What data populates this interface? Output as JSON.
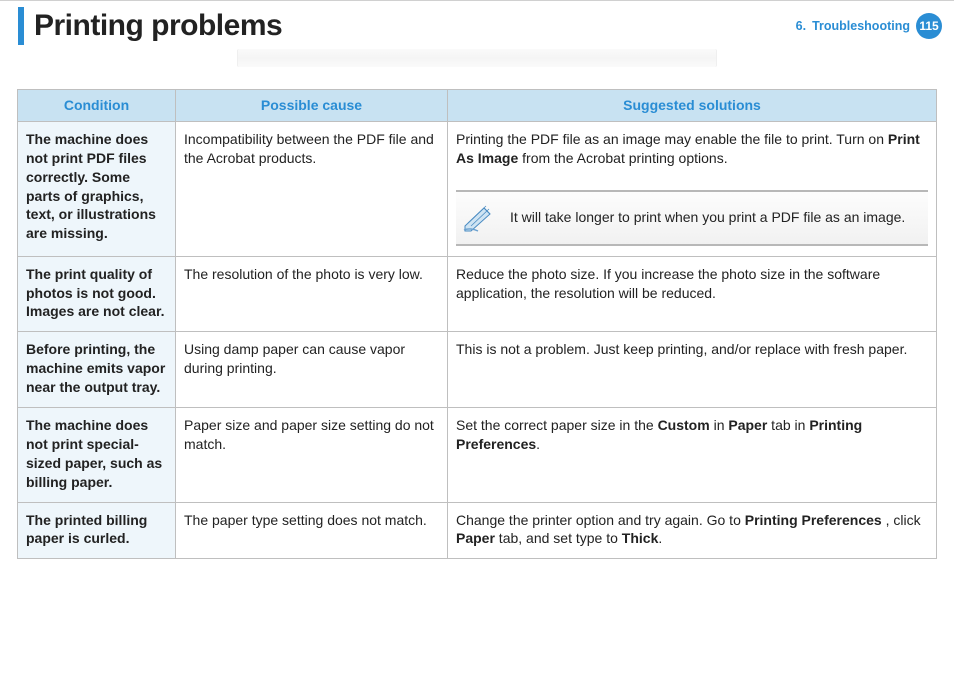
{
  "header": {
    "title": "Printing problems",
    "chapter_num": "6.",
    "chapter_name": "Troubleshooting",
    "page_number": "115"
  },
  "table": {
    "headers": {
      "condition": "Condition",
      "cause": "Possible cause",
      "solution": "Suggested solutions"
    },
    "rows": [
      {
        "condition": "The machine does not print PDF files correctly. Some parts of graphics, text, or illustrations are missing.",
        "cause": "Incompatibility between the PDF file and the Acrobat products.",
        "solution_pre": "Printing the PDF file as an image may enable the file to print. Turn on ",
        "solution_bold1": "Print As Image",
        "solution_post": " from the Acrobat printing options.",
        "note": "It will take longer to print when you print a PDF file as an image."
      },
      {
        "condition": "The print quality of photos is not good. Images are not clear.",
        "cause": "The resolution of the photo is very low.",
        "solution_plain": "Reduce the photo size. If you increase the photo size in the software application, the resolution will be reduced."
      },
      {
        "condition": "Before printing, the machine emits vapor near the output tray.",
        "cause": "Using damp paper can cause vapor during printing.",
        "solution_plain": "This is not a problem. Just keep printing, and/or replace with fresh paper."
      },
      {
        "condition": "The machine does not print special-sized paper, such as billing paper.",
        "cause": "Paper size and paper size setting do not match.",
        "sol_parts": [
          "Set the correct paper size in the ",
          "Custom",
          " in ",
          "Paper",
          " tab in ",
          "Printing Preferences",
          "."
        ]
      },
      {
        "condition": "The printed billing paper is curled.",
        "cause": "The paper type setting does not match.",
        "sol_parts": [
          "Change the printer option and try again. Go to ",
          "Printing Preferences",
          " , click ",
          "Paper",
          " tab, and set type to ",
          "Thick",
          "."
        ]
      }
    ]
  }
}
